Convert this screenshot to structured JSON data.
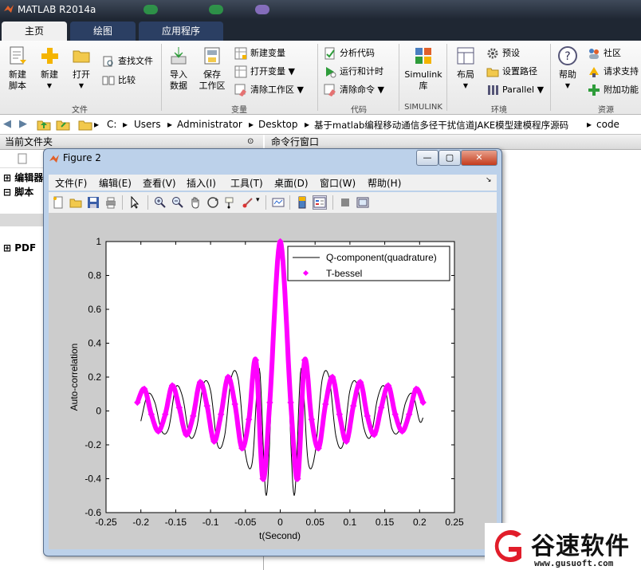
{
  "app": {
    "title": "MATLAB R2014a"
  },
  "tabs": [
    {
      "label": "主页",
      "active": true
    },
    {
      "label": "绘图",
      "active": false
    },
    {
      "label": "应用程序",
      "active": false
    }
  ],
  "ribbon": {
    "file": {
      "new_script": [
        "新建",
        "脚本"
      ],
      "new": "新建",
      "open": "打开",
      "find_files": "查找文件",
      "compare": "比较",
      "group": "文件"
    },
    "variable": {
      "import": [
        "导入",
        "数据"
      ],
      "save_ws": [
        "保存",
        "工作区"
      ],
      "new_var": "新建变量",
      "open_var": "打开变量",
      "clear_ws": "清除工作区",
      "group": "变量"
    },
    "code": {
      "analyze": "分析代码",
      "run_time": "运行和计时",
      "clear_cmd": "清除命令",
      "group": "代码"
    },
    "simulink": {
      "lib": [
        "Simulink",
        "库"
      ],
      "group": "SIMULINK"
    },
    "env": {
      "layout": "布局",
      "prefs": "预设",
      "set_path": "设置路径",
      "parallel": "Parallel",
      "group": "环境"
    },
    "resources": {
      "help": "帮助",
      "community": "社区",
      "support": "请求支持",
      "addons": "附加功能",
      "group": "资源"
    }
  },
  "address": {
    "crumbs": [
      "C:",
      "Users",
      "Administrator",
      "Desktop",
      "基于matlab编程移动通信多径干扰信道JAKE模型建模程序源码",
      "code"
    ]
  },
  "panes": {
    "current_folder": "当前文件夹",
    "command_window": "命令行窗口",
    "tree": [
      "编辑器",
      "脚本",
      "PDF"
    ]
  },
  "figure": {
    "title": "Figure 2",
    "menu": [
      "文件(F)",
      "编辑(E)",
      "查看(V)",
      "插入(I)",
      "工具(T)",
      "桌面(D)",
      "窗口(W)",
      "帮助(H)"
    ]
  },
  "chart_data": {
    "type": "line",
    "xlabel": "t(Second)",
    "ylabel": "Auto-correlation",
    "xlim": [
      -0.25,
      0.25
    ],
    "ylim": [
      -0.6,
      1
    ],
    "xticks": [
      "-0.25",
      "-0.2",
      "-0.15",
      "-0.1",
      "-0.05",
      "0",
      "0.05",
      "0.1",
      "0.15",
      "0.2",
      "0.25"
    ],
    "yticks": [
      "-0.6",
      "-0.4",
      "-0.2",
      "0",
      "0.2",
      "0.4",
      "0.6",
      "0.8",
      "1"
    ],
    "legend_position": "top-right",
    "grid": false,
    "series": [
      {
        "name": "Q-component(quadrature)",
        "color": "#000000",
        "style": "line",
        "x": [
          -0.2,
          -0.19,
          -0.18,
          -0.17,
          -0.16,
          -0.15,
          -0.14,
          -0.13,
          -0.12,
          -0.11,
          -0.1,
          -0.09,
          -0.08,
          -0.07,
          -0.06,
          -0.05,
          -0.04,
          -0.03,
          -0.02,
          -0.01,
          0,
          0.01,
          0.02,
          0.03,
          0.04,
          0.05,
          0.06,
          0.07,
          0.08,
          0.09,
          0.1,
          0.11,
          0.12,
          0.13,
          0.14,
          0.15,
          0.16,
          0.17,
          0.18,
          0.19,
          0.2,
          0.205
        ],
        "y": [
          -0.06,
          0.1,
          0.05,
          -0.12,
          -0.1,
          0.14,
          0.08,
          -0.15,
          -0.1,
          0.16,
          0.12,
          -0.2,
          -0.15,
          0.2,
          0.18,
          -0.25,
          -0.3,
          0.25,
          -0.5,
          0.35,
          1.0,
          0.35,
          -0.5,
          0.25,
          -0.3,
          -0.25,
          0.18,
          0.2,
          -0.15,
          -0.2,
          0.12,
          0.16,
          -0.1,
          -0.15,
          0.08,
          0.14,
          -0.1,
          -0.12,
          0.05,
          0.1,
          -0.06,
          -0.04
        ]
      },
      {
        "name": "T-bessel",
        "color": "#ff00ff",
        "style": "marker",
        "x": [
          -0.205,
          -0.195,
          -0.185,
          -0.175,
          -0.165,
          -0.155,
          -0.145,
          -0.135,
          -0.125,
          -0.115,
          -0.105,
          -0.095,
          -0.085,
          -0.075,
          -0.065,
          -0.055,
          -0.045,
          -0.035,
          -0.025,
          -0.015,
          0,
          0.015,
          0.025,
          0.035,
          0.045,
          0.055,
          0.065,
          0.075,
          0.085,
          0.095,
          0.105,
          0.115,
          0.125,
          0.135,
          0.145,
          0.155,
          0.165,
          0.175,
          0.185,
          0.195,
          0.205
        ],
        "y": [
          0.05,
          0.13,
          -0.02,
          -0.12,
          -0.02,
          0.15,
          0.02,
          -0.14,
          -0.03,
          0.17,
          0.03,
          -0.18,
          -0.02,
          0.2,
          0.04,
          -0.22,
          -0.05,
          0.3,
          -0.4,
          0.05,
          1.0,
          0.05,
          -0.4,
          0.3,
          -0.05,
          -0.22,
          0.04,
          0.2,
          -0.02,
          -0.18,
          0.03,
          0.17,
          -0.03,
          -0.14,
          0.02,
          0.15,
          -0.02,
          -0.12,
          -0.02,
          0.13,
          0.05
        ]
      }
    ]
  },
  "watermark": {
    "brand": "谷速软件",
    "url": "www.gusuoft.com"
  },
  "colors": {
    "accent": "#ff00ff",
    "dark": "#1f2733",
    "tabblue": "#2b3f63",
    "wm_red": "#e11d2a"
  }
}
